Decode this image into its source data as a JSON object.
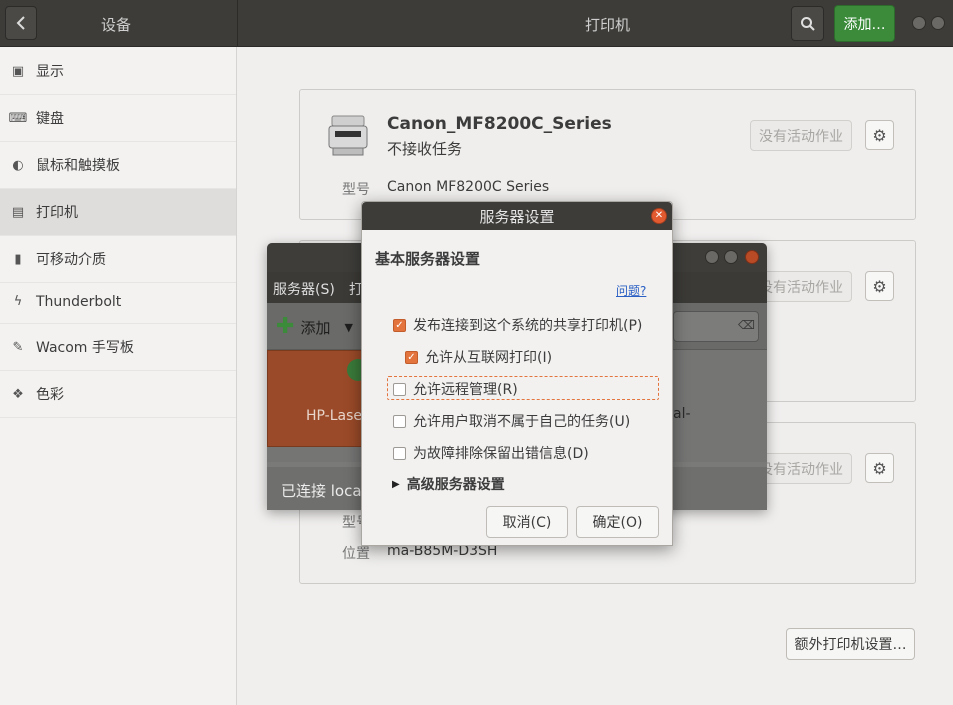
{
  "header": {
    "section_title": "设备",
    "page_title": "打印机",
    "add_label": "添加…"
  },
  "sidebar": {
    "items": [
      {
        "label": "显示",
        "icon": "display-icon"
      },
      {
        "label": "键盘",
        "icon": "keyboard-icon"
      },
      {
        "label": "鼠标和触摸板",
        "icon": "mouse-icon"
      },
      {
        "label": "打印机",
        "icon": "printer-icon",
        "selected": true
      },
      {
        "label": "可移动介质",
        "icon": "usb-drive-icon"
      },
      {
        "label": "Thunderbolt",
        "icon": "thunderbolt-icon"
      },
      {
        "label": "Wacom 手写板",
        "icon": "tablet-icon"
      },
      {
        "label": "色彩",
        "icon": "color-icon"
      }
    ]
  },
  "printers": [
    {
      "name": "Canon_MF8200C_Series",
      "status": "不接收任务",
      "model_label": "型号",
      "model": "Canon MF8200C Series",
      "jobs": "没有活动作业"
    },
    {
      "jobs": "没有活动作业"
    },
    {
      "jobs": "没有活动作业",
      "model_label": "型号",
      "location_label": "位置",
      "location": "ma-B85M-D3SH"
    }
  ],
  "extra_settings_label": "额外打印机设置…",
  "bg_window": {
    "menu_server": "服务器(S)",
    "menu_second": "打",
    "add_label": "添加",
    "printer_card": "HP-Lase",
    "partial_text": "al-",
    "status": "已连接 local"
  },
  "dialog": {
    "title": "服务器设置",
    "section": "基本服务器设置",
    "help_link": "问题?",
    "options": [
      {
        "label": "发布连接到这个系统的共享打印机(P)",
        "checked": true
      },
      {
        "label": "允许从互联网打印(I)",
        "checked": true
      },
      {
        "label": "允许远程管理(R)",
        "checked": false
      },
      {
        "label": "允许用户取消不属于自己的任务(U)",
        "checked": false
      },
      {
        "label": "为故障排除保留出错信息(D)",
        "checked": false
      }
    ],
    "advanced": "高级服务器设置",
    "cancel": "取消(C)",
    "ok": "确定(O)"
  },
  "colors": {
    "accent": "#e3743d",
    "add_button": "#3b8b3b",
    "header_bg": "#3d3c38"
  }
}
